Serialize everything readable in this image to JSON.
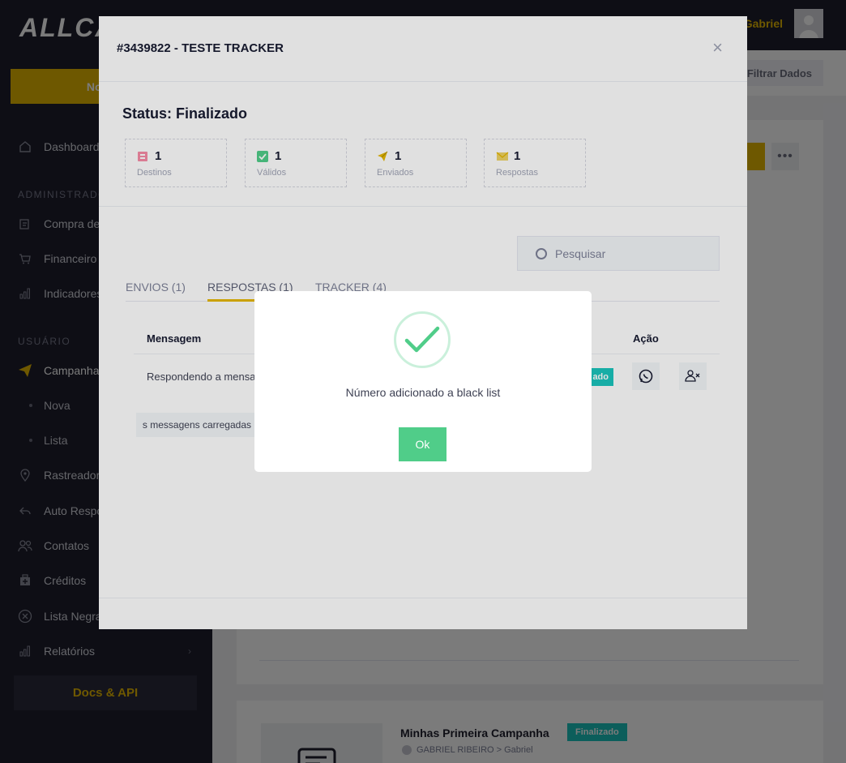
{
  "app": {
    "logo_text": "ALLCALLET",
    "new_button": "Nova C",
    "docs_button": "Docs & API",
    "colors": {
      "accent": "#e6b800",
      "sidebar": "#1e1e2d",
      "success": "#50cd89",
      "badge": "#1bc5bd"
    }
  },
  "header": {
    "user_name": "Gabriel",
    "filter_button": "Filtrar Dados"
  },
  "sidebar": {
    "dashboard": "Dashboard",
    "section_admin": "ADMINISTRADO",
    "admin_items": [
      {
        "label": "Compra de",
        "icon": "receipt-icon"
      },
      {
        "label": "Financeiro",
        "icon": "cart-icon"
      },
      {
        "label": "Indicadores",
        "icon": "bar-chart-icon"
      }
    ],
    "section_user": "USUÁRIO",
    "campanha": "Campanha",
    "campanha_sub": [
      "Nova",
      "Lista"
    ],
    "user_items": [
      {
        "label": "Rastreadore",
        "icon": "pin-icon"
      },
      {
        "label": "Auto Respo",
        "icon": "reply-icon"
      },
      {
        "label": "Contatos",
        "icon": "users-icon"
      },
      {
        "label": "Créditos",
        "icon": "wallet-icon"
      },
      {
        "label": "Lista Negra",
        "icon": "block-icon"
      },
      {
        "label": "Relatórios",
        "icon": "bar-chart-icon"
      }
    ]
  },
  "background_card": {
    "campaign_title": "Minhas Primeira Campanha",
    "campaign_status": "Finalizado",
    "campaign_meta": "GABRIEL RIBEIRO > Gabriel",
    "more_glyph": "•••"
  },
  "modal": {
    "title": "#3439822 - TESTE TRACKER",
    "close_glyph": "×",
    "status": "Status: Finalizado",
    "stats": [
      {
        "value": "1",
        "label": "Destinos",
        "color": "#f1416c"
      },
      {
        "value": "1",
        "label": "Válidos",
        "color": "#50cd89"
      },
      {
        "value": "1",
        "label": "Enviados",
        "color": "#e6b800"
      },
      {
        "value": "1",
        "label": "Respostas",
        "color": "#e6b800"
      }
    ],
    "search_placeholder": "Pesquisar",
    "tabs": [
      "ENVIOS (1)",
      "RESPOSTAS (1)",
      "TRACKER (4)"
    ],
    "columns": {
      "message": "Mensagem",
      "action": "Ação"
    },
    "row": {
      "message": "Respondendo a mensa",
      "badge": "ado"
    },
    "loaded_text": "s messagens carregadas"
  },
  "alert": {
    "message": "Número adicionado a black list",
    "ok_button": "Ok"
  }
}
